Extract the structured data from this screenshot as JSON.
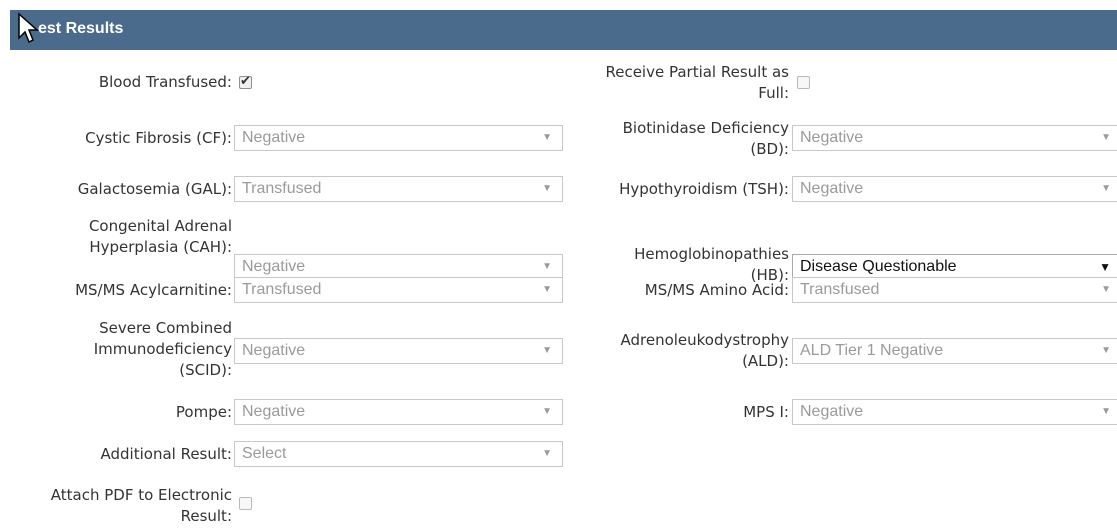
{
  "header": {
    "title": "est Results"
  },
  "left": {
    "blood_transfused": {
      "label": "Blood Transfused:",
      "checked": true
    },
    "cf": {
      "label": [
        "Cystic Fibrosis (CF):"
      ],
      "value": "Negative"
    },
    "gal": {
      "label": [
        "Galactosemia (GAL):"
      ],
      "value": "Transfused"
    },
    "cah": {
      "label": [
        "Congenital Adrenal",
        "Hyperplasia (CAH):"
      ],
      "value": "Negative"
    },
    "acyl": {
      "label": [
        "MS/MS Acylcarnitine:"
      ],
      "value": "Transfused"
    },
    "scid": {
      "label": [
        "Severe Combined",
        "Immunodeficiency",
        "(SCID):"
      ],
      "value": "Negative"
    },
    "pompe": {
      "label": [
        "Pompe:"
      ],
      "value": "Negative"
    },
    "additional": {
      "label": [
        "Additional Result:"
      ],
      "value": "Select"
    },
    "attach_pdf": {
      "label": [
        "Attach PDF to Electronic",
        "Result:"
      ],
      "checked": false
    }
  },
  "right": {
    "partial": {
      "label": [
        "Receive Partial Result as",
        "Full:"
      ],
      "checked": false
    },
    "bd": {
      "label": [
        "Biotinidase Deficiency",
        "(BD):"
      ],
      "value": "Negative"
    },
    "tsh": {
      "label": [
        "Hypothyroidism (TSH):"
      ],
      "value": "Negative"
    },
    "hb": {
      "label": [
        "Hemoglobinopathies",
        "(HB):"
      ],
      "value": "Disease Questionable"
    },
    "amino": {
      "label": [
        "MS/MS Amino Acid:"
      ],
      "value": "Transfused"
    },
    "ald": {
      "label": [
        "Adrenoleukodystrophy",
        "(ALD):"
      ],
      "value": "ALD Tier 1 Negative"
    },
    "mps": {
      "label": [
        "MPS I:"
      ],
      "value": "Negative"
    }
  },
  "icons": {
    "dropdown": "▼",
    "check": "✔"
  }
}
